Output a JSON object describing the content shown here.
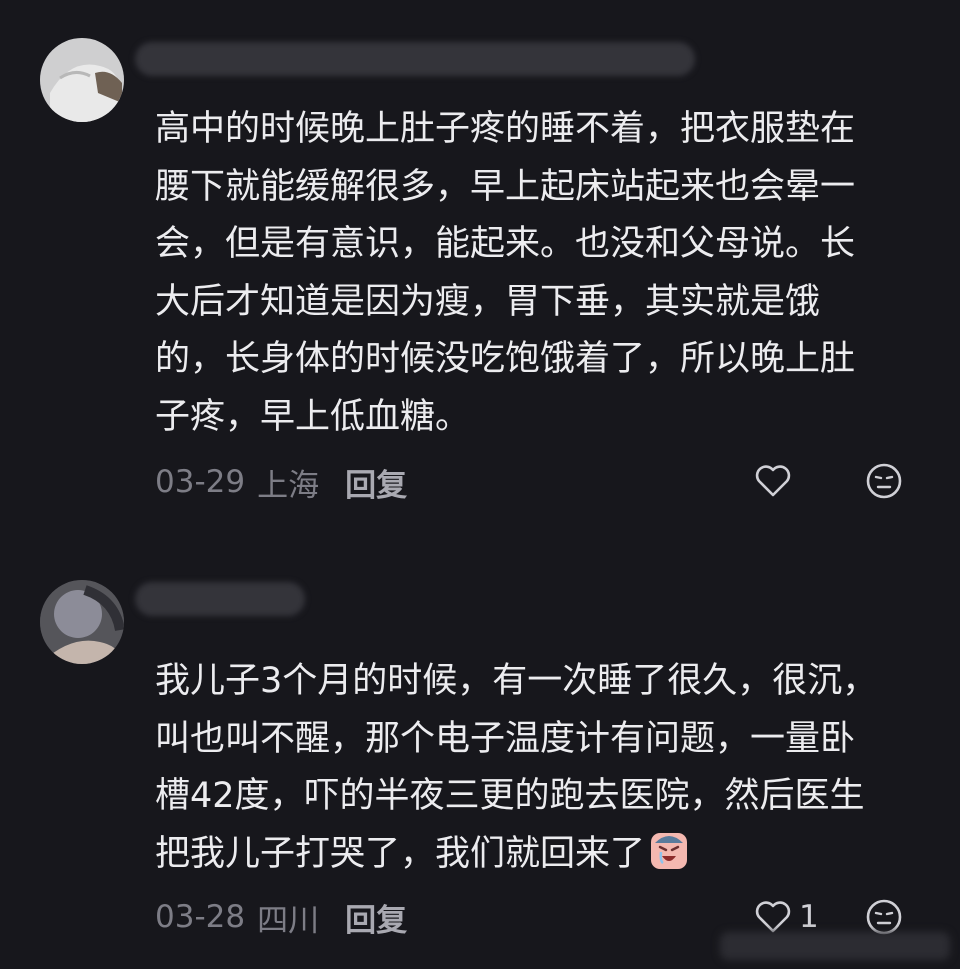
{
  "comments": [
    {
      "text": "高中的时候晚上肚子疼的睡不着，把衣服垫在\n腰下就能缓解很多，早上起床站起来也会晕一\n会，但是有意识，能起来。也没和父母说。长\n大后才知道是因为瘦，胃下垂，其实就是饿\n的，长身体的时候没吃饱饿着了，所以晚上肚\n子疼，早上低血糖。",
      "date": "03-29",
      "location": "上海",
      "reply_label": "回复",
      "like_count": "",
      "icons": [
        "avatar",
        "heart-icon",
        "dislike-face-icon"
      ]
    },
    {
      "text": "我儿子3个月的时候，有一次睡了很久，很沉，\n叫也叫不醒，那个电子温度计有问题，一量卧\n槽42度，吓的半夜三更的跑去医院，然后医生\n把我儿子打哭了，我们就回来了",
      "date": "03-28",
      "location": "四川",
      "reply_label": "回复",
      "like_count": "1",
      "icons": [
        "avatar",
        "crying-emoji-icon",
        "heart-icon",
        "dislike-face-icon"
      ]
    }
  ],
  "colors": {
    "background": "#17171c",
    "text": "#ececef",
    "muted": "#7d7d86",
    "reply": "#a9a9b1"
  }
}
